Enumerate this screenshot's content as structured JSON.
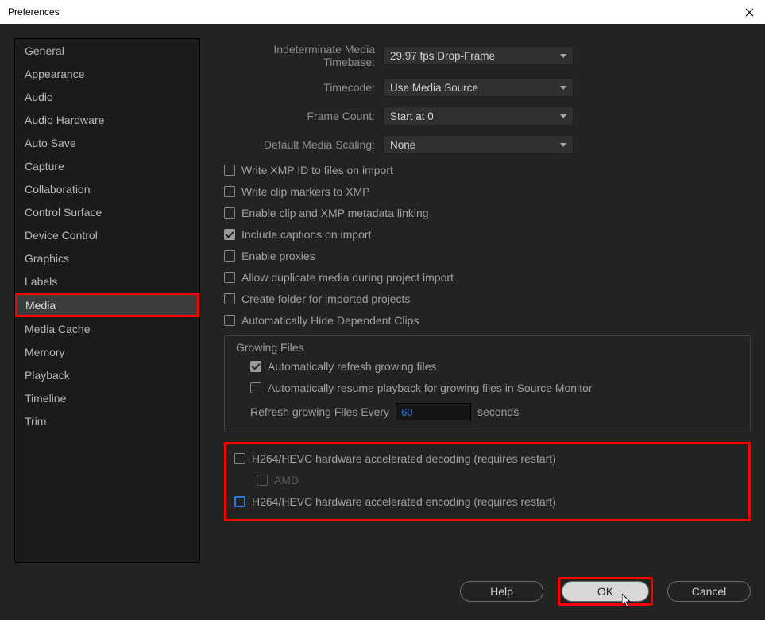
{
  "window": {
    "title": "Preferences"
  },
  "sidebar": {
    "items": [
      {
        "label": "General",
        "selected": false
      },
      {
        "label": "Appearance",
        "selected": false
      },
      {
        "label": "Audio",
        "selected": false
      },
      {
        "label": "Audio Hardware",
        "selected": false
      },
      {
        "label": "Auto Save",
        "selected": false
      },
      {
        "label": "Capture",
        "selected": false
      },
      {
        "label": "Collaboration",
        "selected": false
      },
      {
        "label": "Control Surface",
        "selected": false
      },
      {
        "label": "Device Control",
        "selected": false
      },
      {
        "label": "Graphics",
        "selected": false
      },
      {
        "label": "Labels",
        "selected": false
      },
      {
        "label": "Media",
        "selected": true,
        "highlighted": true
      },
      {
        "label": "Media Cache",
        "selected": false
      },
      {
        "label": "Memory",
        "selected": false
      },
      {
        "label": "Playback",
        "selected": false
      },
      {
        "label": "Timeline",
        "selected": false
      },
      {
        "label": "Trim",
        "selected": false
      }
    ]
  },
  "dropdowns": {
    "timebase": {
      "label": "Indeterminate Media Timebase:",
      "value": "29.97 fps Drop-Frame"
    },
    "timecode": {
      "label": "Timecode:",
      "value": "Use Media Source"
    },
    "framecount": {
      "label": "Frame Count:",
      "value": "Start at 0"
    },
    "scaling": {
      "label": "Default Media Scaling:",
      "value": "None"
    }
  },
  "checkboxes": {
    "xmpid": {
      "label": "Write XMP ID to files on import",
      "checked": false
    },
    "clipmarkers": {
      "label": "Write clip markers to XMP",
      "checked": false
    },
    "metadatalink": {
      "label": "Enable clip and XMP metadata linking",
      "checked": false
    },
    "captions": {
      "label": "Include captions on import",
      "checked": true
    },
    "proxies": {
      "label": "Enable proxies",
      "checked": false
    },
    "duplicate": {
      "label": "Allow duplicate media during project import",
      "checked": false
    },
    "createfolder": {
      "label": "Create folder for imported projects",
      "checked": false
    },
    "hidedeps": {
      "label": "Automatically Hide Dependent Clips",
      "checked": false
    },
    "autorefresh": {
      "label": "Automatically refresh growing files",
      "checked": true
    },
    "autoresume": {
      "label": "Automatically resume playback for growing files in Source Monitor",
      "checked": false
    },
    "hwdecoding": {
      "label": "H264/HEVC hardware accelerated decoding (requires restart)",
      "checked": false
    },
    "amd": {
      "label": "AMD",
      "checked": false,
      "disabled": true
    },
    "hwencoding": {
      "label": "H264/HEVC hardware accelerated encoding (requires restart)",
      "checked": false
    }
  },
  "growing": {
    "title": "Growing Files",
    "refresh_label": "Refresh growing Files Every",
    "refresh_value": "60",
    "refresh_unit": "seconds"
  },
  "footer": {
    "help": "Help",
    "ok": "OK",
    "cancel": "Cancel"
  }
}
